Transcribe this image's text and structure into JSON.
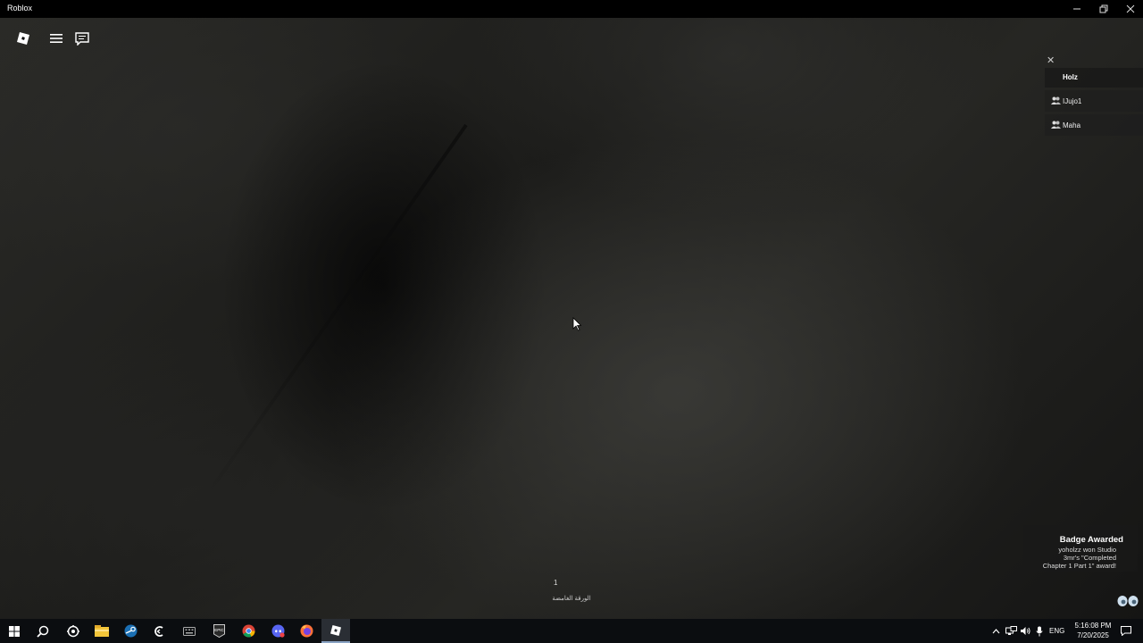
{
  "window": {
    "title": "Roblox"
  },
  "player_list": {
    "header": "Holz",
    "players": [
      "IJujo1",
      "Maha"
    ]
  },
  "badge_notification": {
    "title": "Badge Awarded",
    "lines": [
      "yoholzz won Studio",
      "3mr's \"Completed",
      "Chapter 1 Part 1\" award!"
    ]
  },
  "hud": {
    "count": "1",
    "label": "الورقة الغامضة"
  },
  "taskbar": {
    "apps": [
      "start-icon",
      "search-icon",
      "steam-client-icon",
      "file-explorer-icon",
      "steam-icon",
      "app-icon",
      "keyboard-icon",
      "epic-games-icon",
      "chrome-icon",
      "discord-icon",
      "firefox-icon",
      "roblox-icon"
    ],
    "language": "ENG",
    "time": "5:16:08 PM",
    "date": "7/20/2025"
  }
}
